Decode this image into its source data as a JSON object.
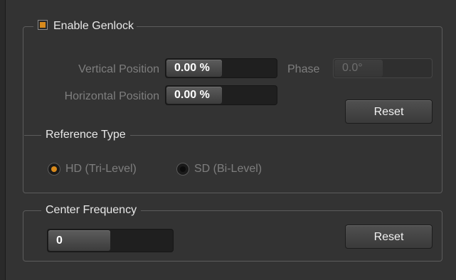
{
  "genlock": {
    "enable_label": "Enable Genlock",
    "enabled": true,
    "vertical_position_label": "Vertical Position",
    "vertical_position_value": "0.00 %",
    "horizontal_position_label": "Horizontal Position",
    "horizontal_position_value": "0.00 %",
    "phase_label": "Phase",
    "phase_value": "0.0°",
    "reset_label": "Reset",
    "reference_type_label": "Reference Type",
    "reference_options": [
      "HD (Tri-Level)",
      "SD (Bi-Level)"
    ],
    "reference_selected": "HD (Tri-Level)"
  },
  "center_frequency": {
    "label": "Center Frequency",
    "value": "0",
    "reset_label": "Reset"
  },
  "colors": {
    "accent": "#d88a1c",
    "background": "#333333"
  }
}
